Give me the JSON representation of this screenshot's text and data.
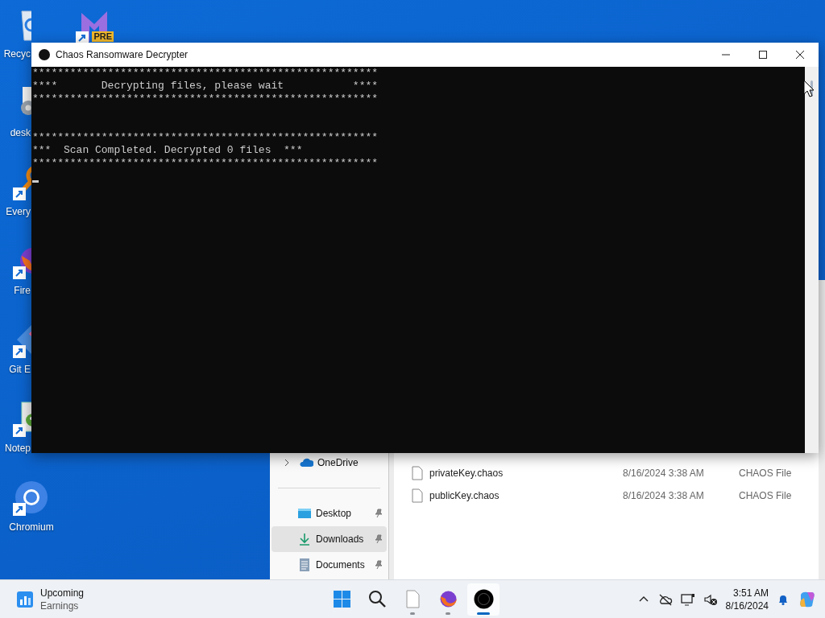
{
  "desktop_icons": [
    {
      "label": "Recyc",
      "kind": "covered",
      "shortcut": false
    },
    {
      "label": "desk",
      "kind": "covered",
      "shortcut": false
    },
    {
      "label": "Every",
      "kind": "covered",
      "shortcut": true
    },
    {
      "label": "Fire",
      "kind": "covered",
      "shortcut": true
    },
    {
      "label": "Git E",
      "kind": "covered",
      "shortcut": true
    },
    {
      "label": "Notep",
      "kind": "covered",
      "shortcut": true
    },
    {
      "label": "Chromium",
      "kind": "full",
      "shortcut": true
    }
  ],
  "desktop_icon_unlabeled": {
    "badge": "PRE",
    "shortcut": true
  },
  "explorer": {
    "nav_items": [
      {
        "label": "OneDrive",
        "kind": "cloud",
        "expandable": true,
        "pinned": false,
        "selected": false
      },
      {
        "label": "Desktop",
        "kind": "desktop",
        "expandable": false,
        "pinned": true,
        "selected": false
      },
      {
        "label": "Downloads",
        "kind": "download",
        "expandable": false,
        "pinned": true,
        "selected": true
      },
      {
        "label": "Documents",
        "kind": "documents",
        "expandable": false,
        "pinned": true,
        "selected": false
      }
    ],
    "files": [
      {
        "name": "privateKey.chaos",
        "date_modified": "8/16/2024 3:38 AM",
        "type": "CHAOS File"
      },
      {
        "name": "publicKey.chaos",
        "date_modified": "8/16/2024 3:38 AM",
        "type": "CHAOS File"
      }
    ]
  },
  "console_window": {
    "title": "Chaos Ransomware Decrypter",
    "blocks": [
      [
        "*******************************************************",
        "****       Decrypting files, please wait           ****",
        "*******************************************************"
      ],
      [
        "*******************************************************",
        "***  Scan Completed. Decrypted 0 files  ***",
        "*******************************************************"
      ]
    ],
    "cursor_visible": true
  },
  "taskbar": {
    "widget": {
      "title": "Upcoming",
      "subtitle": "Earnings"
    },
    "apps": [
      {
        "kind": "start",
        "running": false,
        "selected": false
      },
      {
        "kind": "search",
        "running": false,
        "selected": false
      },
      {
        "kind": "file",
        "running": true,
        "selected": false
      },
      {
        "kind": "firefox",
        "running": true,
        "selected": false
      },
      {
        "kind": "chaos",
        "running": true,
        "selected": true
      }
    ],
    "time": "3:51 AM",
    "date": "8/16/2024"
  }
}
